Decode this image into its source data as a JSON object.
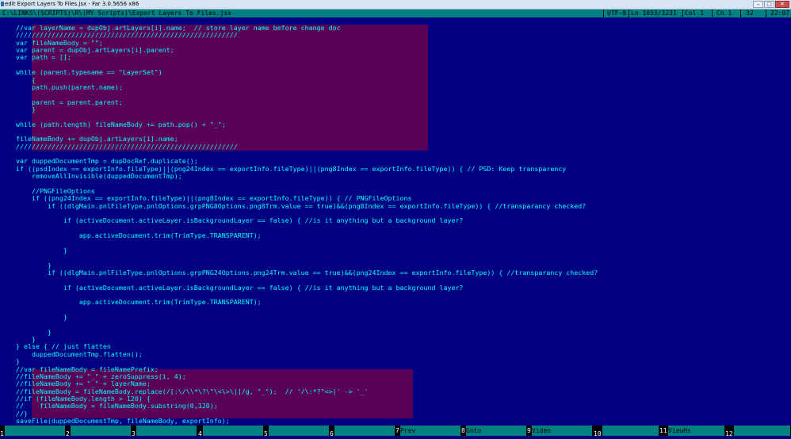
{
  "window": {
    "title": "edit Export Layers To Files.jsx - Far 3.0.5656 x86",
    "minimize_label": "–",
    "maximize_label": "□",
    "close_label": "✕"
  },
  "status": {
    "path": "C:\\LINKS\\(SCRIPTS)\\R\\(MY Scripts)\\Export Layers To Files.jsx",
    "encoding": "UTF-8",
    "line": "Ln 1053/1231",
    "col": "Col 1",
    "ch": "Ch 1",
    "code": "32",
    "time": "22:07"
  },
  "code_lines": [
    "    //var layerName = dupObj.artLayers[i].name;  // store layer name before change doc",
    "    ////////////////////////////////////////////////////////",
    "    var fileNameBody = \"\";",
    "    var parent = dupObj.artLayers[i].parent;",
    "    var path = [];",
    "",
    "    while (parent.typename == \"LayerSet\")",
    "        {",
    "        path.push(parent.name);",
    "",
    "        parent = parent.parent;",
    "        }",
    "",
    "    while (path.length) fileNameBody += path.pop() + \"_\";",
    "",
    "    fileNameBody += dupObj.artLayers[i].name;",
    "    ////////////////////////////////////////////////////////",
    "",
    "    var duppedDocumentTmp = dupDocRef.duplicate();",
    "    if ((psdIndex == exportInfo.fileType)||(png24Index == exportInfo.fileType)||(png8Index == exportInfo.fileType)) { // PSD: Keep transparency",
    "        removeAllInvisible(duppedDocumentTmp);",
    "",
    "        //PNGFileOptions",
    "        if ((png24Index == exportInfo.fileType)||(png8Index == exportInfo.fileType)) { // PNGFileOptions",
    "            if ((dlgMain.pnlFileType.pnlOptions.grpPNG8Options.png8Trm.value == true)&&(png8Index == exportInfo.fileType)) { //transparancy checked?",
    "",
    "                if (activeDocument.activeLayer.isBackgroundLayer == false) { //is it anything but a background layer?",
    "",
    "                    app.activeDocument.trim(TrimType.TRANSPARENT);",
    "",
    "                }",
    "",
    "            }",
    "            if ((dlgMain.pnlFileType.pnlOptions.grpPNG24Options.png24Trm.value == true)&&(png24Index == exportInfo.fileType)) { //transparancy checked?",
    "",
    "                if (activeDocument.activeLayer.isBackgroundLayer == false) { //is it anything but a background layer?",
    "",
    "                    app.activeDocument.trim(TrimType.TRANSPARENT);",
    "",
    "                }",
    "",
    "            }",
    "        }",
    "    } else { // just flatten",
    "        duppedDocumentTmp.flatten();",
    "    }",
    "    //var fileNameBody = fileNamePrefix;",
    "    //fileNameBody += \"_\" + zeroSuppress(i, 4);",
    "    //fileNameBody += \"_\" + layerName;",
    "    //fileNameBody = fileNameBody.replace(/[:\\/\\\\*\\?\\\"\\<\\>\\|]/g, \"_\");  // '/\\:*?\"<>|' -> '_'",
    "    //if (fileNameBody.length > 120) {",
    "    //    fileNameBody = fileNameBody.substring(0,120);",
    "    //}",
    "    saveFile(duppedDocumentTmp, fileNameBody, exportInfo);"
  ],
  "keybar": [
    {
      "num": "1",
      "label": ""
    },
    {
      "num": "2",
      "label": ""
    },
    {
      "num": "3",
      "label": ""
    },
    {
      "num": "4",
      "label": ""
    },
    {
      "num": "5",
      "label": ""
    },
    {
      "num": "6",
      "label": ""
    },
    {
      "num": "7",
      "label": "Prev"
    },
    {
      "num": "8",
      "label": "Goto"
    },
    {
      "num": "9",
      "label": "Video"
    },
    {
      "num": "10",
      "label": ""
    },
    {
      "num": "11",
      "label": "ViewHs"
    },
    {
      "num": "12",
      "label": ""
    }
  ],
  "colors": {
    "background": "#000080",
    "text": "#00ffff",
    "selection": "#5b0057",
    "statusbar": "#008080",
    "keybar_label": "#008080"
  }
}
